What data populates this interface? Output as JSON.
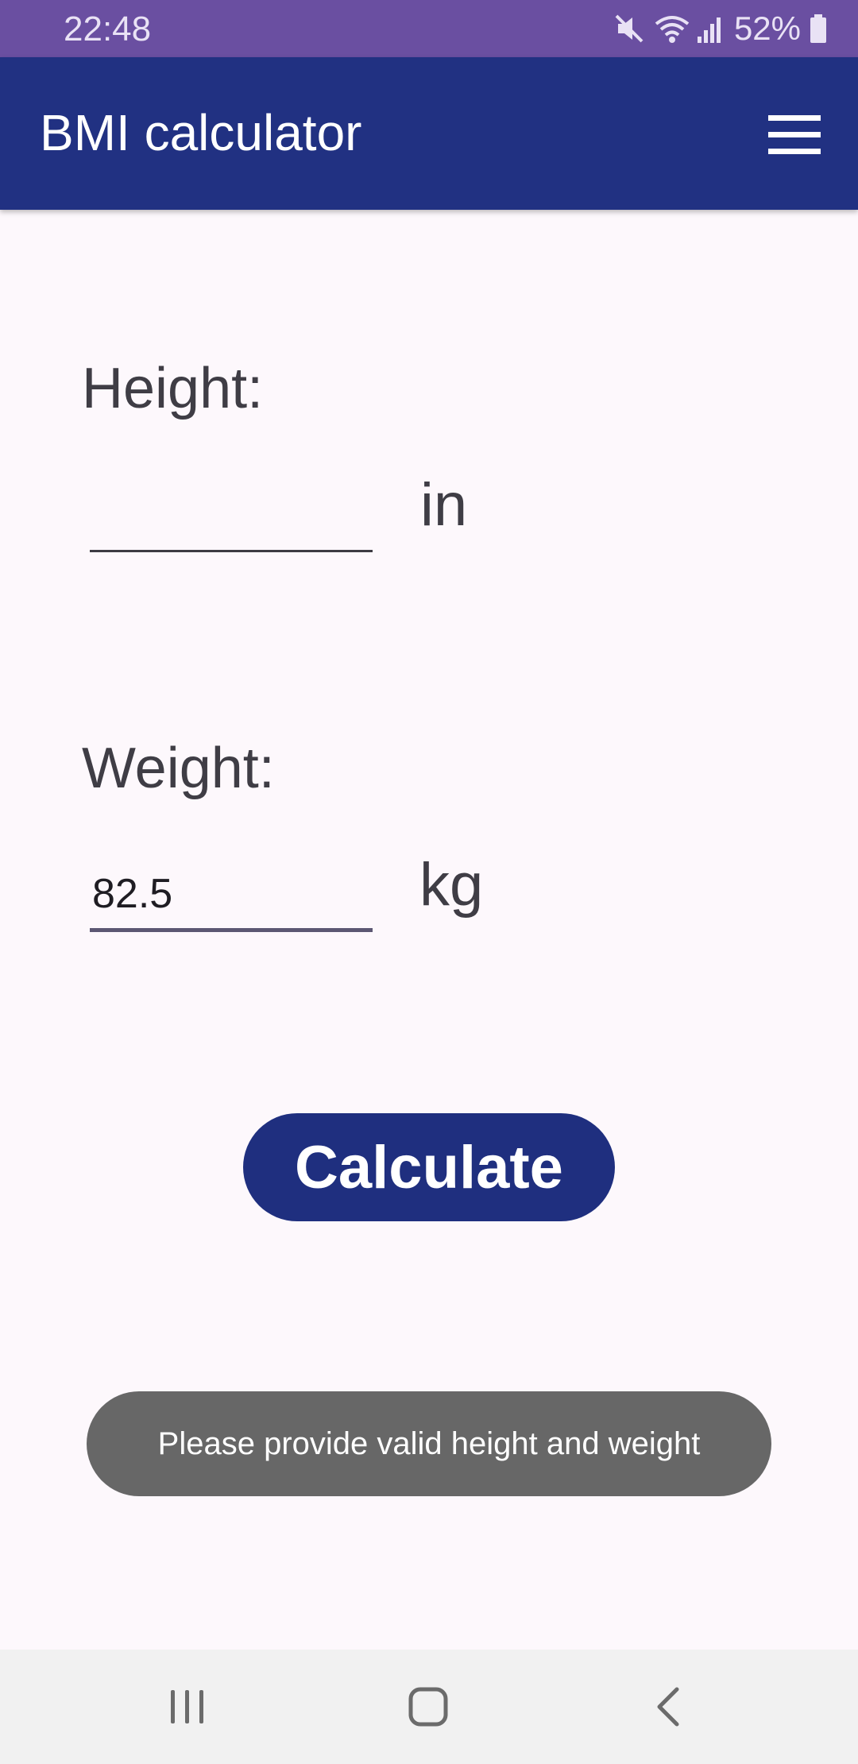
{
  "status_bar": {
    "time": "22:48",
    "battery": "52%",
    "icons": [
      "mute-icon",
      "wifi-icon",
      "signal-icon",
      "battery-icon"
    ]
  },
  "app_bar": {
    "title": "BMI calculator",
    "menu_icon": "hamburger-menu-icon"
  },
  "form": {
    "height": {
      "label": "Height:",
      "value": "",
      "unit": "in"
    },
    "weight": {
      "label": "Weight:",
      "value": "82.5",
      "unit": "kg"
    }
  },
  "calculate_button": {
    "label": "Calculate"
  },
  "toast": {
    "message": "Please provide valid height and weight"
  },
  "nav_bar": {
    "icons": [
      "recents-icon",
      "home-icon",
      "back-icon"
    ]
  },
  "colors": {
    "status_bar": "#6a4fa1",
    "app_bar": "#213182",
    "button": "#1f2f7f",
    "toast": "#676767",
    "background": "#fdf8fc"
  }
}
